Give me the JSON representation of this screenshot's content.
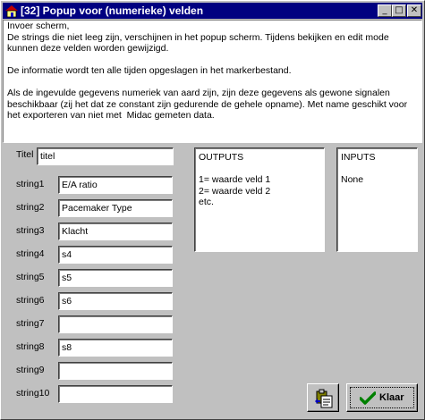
{
  "window": {
    "title": "[32]  Popup voor (numerieke) velden",
    "controls": {
      "minimize": "_",
      "maximize": "□",
      "close": "✕"
    }
  },
  "info_text": [
    "Invoer scherm,",
    "De strings die niet leeg zijn, verschijnen in het popup scherm. Tijdens bekijken en edit mode kunnen deze velden worden gewijzigd.",
    "",
    "De informatie wordt ten alle tijden opgeslagen in het markerbestand.",
    "",
    "Als de ingevulde gegevens numeriek van aard zijn, zijn deze gegevens als gewone signalen beschikbaar (zij het dat ze constant zijn gedurende de gehele opname). Met name geschikt voor het exporteren van niet met  Midac gemeten data."
  ],
  "titel": {
    "label": "Titel",
    "value": "titel"
  },
  "strings": [
    {
      "label": "string1",
      "value": "E/A ratio"
    },
    {
      "label": "string2",
      "value": "Pacemaker Type"
    },
    {
      "label": "string3",
      "value": "Klacht"
    },
    {
      "label": "string4",
      "value": "s4"
    },
    {
      "label": "string5",
      "value": "s5"
    },
    {
      "label": "string6",
      "value": "s6"
    },
    {
      "label": "string7",
      "value": ""
    },
    {
      "label": "string8",
      "value": "s8"
    },
    {
      "label": "string9",
      "value": ""
    },
    {
      "label": "string10",
      "value": ""
    }
  ],
  "outputs": {
    "text": "OUTPUTS\n\n1= waarde veld 1\n2= waarde veld 2\netc."
  },
  "inputs": {
    "text": "INPUTS\n\nNone"
  },
  "buttons": {
    "clipboard_icon": "clipboard-icon",
    "klaar_label": "Klaar",
    "klaar_icon": "checkmark-icon"
  },
  "colors": {
    "titlebar": "#000080",
    "face": "#c0c0c0",
    "check": "#008000"
  }
}
